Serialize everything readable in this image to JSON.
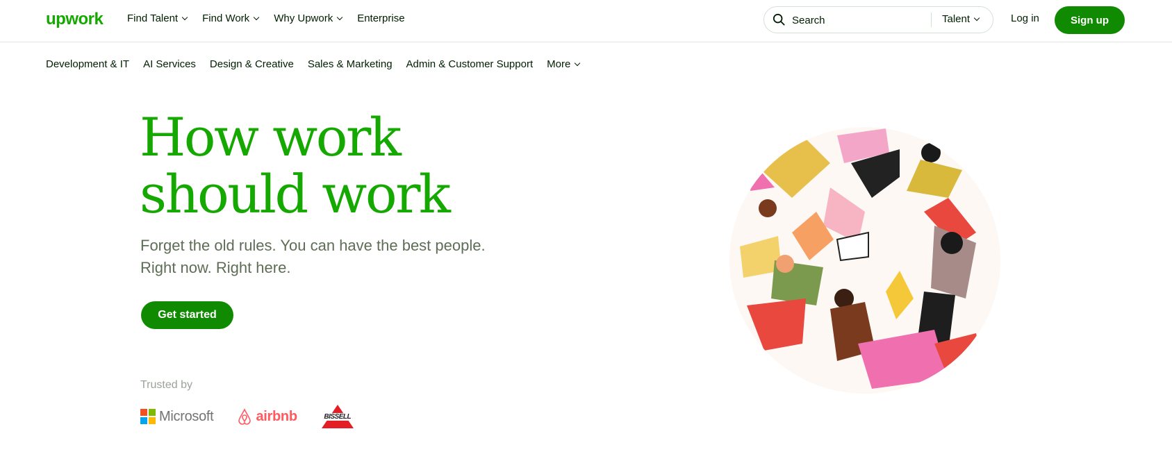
{
  "header": {
    "logo": "upwork",
    "nav": [
      {
        "label": "Find Talent",
        "dropdown": true
      },
      {
        "label": "Find Work",
        "dropdown": true
      },
      {
        "label": "Why Upwork",
        "dropdown": true
      },
      {
        "label": "Enterprise",
        "dropdown": false
      }
    ],
    "search": {
      "placeholder": "Search",
      "select_value": "Talent"
    },
    "login_label": "Log in",
    "signup_label": "Sign up"
  },
  "categories": [
    "Development & IT",
    "AI Services",
    "Design & Creative",
    "Sales & Marketing",
    "Admin & Customer Support",
    "More"
  ],
  "hero": {
    "title_line1": "How work",
    "title_line2": "should work",
    "subtitle_line1": "Forget the old rules. You can have the best people.",
    "subtitle_line2": "Right now. Right here.",
    "cta_label": "Get started"
  },
  "trusted": {
    "label": "Trusted by",
    "logos": [
      "Microsoft",
      "airbnb",
      "BISSELL"
    ]
  },
  "colors": {
    "brand_green": "#14a800",
    "button_green": "#108a00",
    "text_dark": "#001e00",
    "subtitle_gray": "#5e6d55"
  }
}
